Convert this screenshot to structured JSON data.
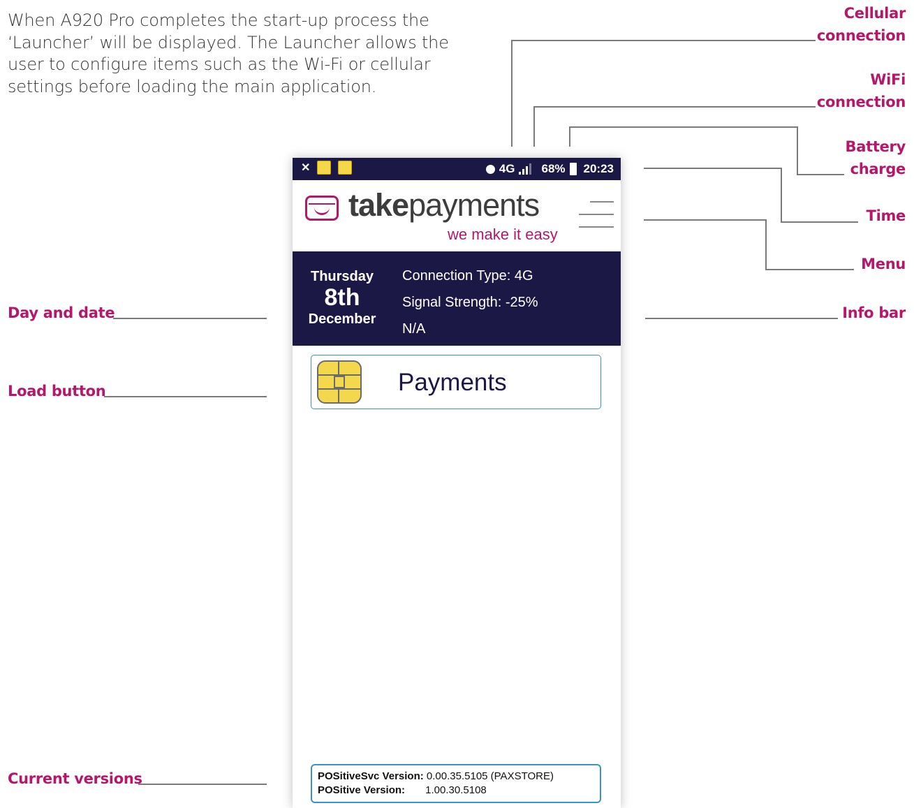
{
  "intro_text": "When A920 Pro completes the start-up process the ‘Launcher’ will be displayed. The Launcher allows the user to configure items such as the Wi-Fi or cellular settings before loading the main application.",
  "callouts": {
    "cellular": [
      "Cellular",
      "connection"
    ],
    "wifi": [
      "WiFi",
      "connection"
    ],
    "battery": [
      "Battery",
      "charge"
    ],
    "time": "Time",
    "menu": "Menu",
    "info_bar": "Info bar",
    "day_and_date": "Day and date",
    "load_button": "Load button",
    "current_versions": "Current versions"
  },
  "status_bar": {
    "network": "4G",
    "battery_percent": "68%",
    "time": "20:23",
    "icons": [
      "bluetooth-off-icon",
      "chip-notification-icon",
      "chip-notification-icon",
      "b-icon",
      "signal-icon",
      "battery-icon"
    ]
  },
  "brand": {
    "name_bold": "take",
    "name_regular": "payments",
    "tagline": "we make it easy"
  },
  "info_bar": {
    "day": "Thursday",
    "date": "8th",
    "month": "December",
    "connection_type": "Connection Type: 4G",
    "signal_strength": "Signal Strength: -25%",
    "extra": "N/A"
  },
  "payments_button": {
    "label": "Payments",
    "icon": "chip-card-icon"
  },
  "versions": {
    "svc_label": "POSitiveSvc Version:",
    "svc_value": "0.00.35.5105 (PAXSTORE)",
    "app_label": "POSitive Version:",
    "app_value": "1.00.30.5108"
  },
  "colors": {
    "accent": "#b5176b",
    "navy": "#1c1846",
    "border_blue": "#3a94c8",
    "chip_yellow": "#f3d74c"
  }
}
